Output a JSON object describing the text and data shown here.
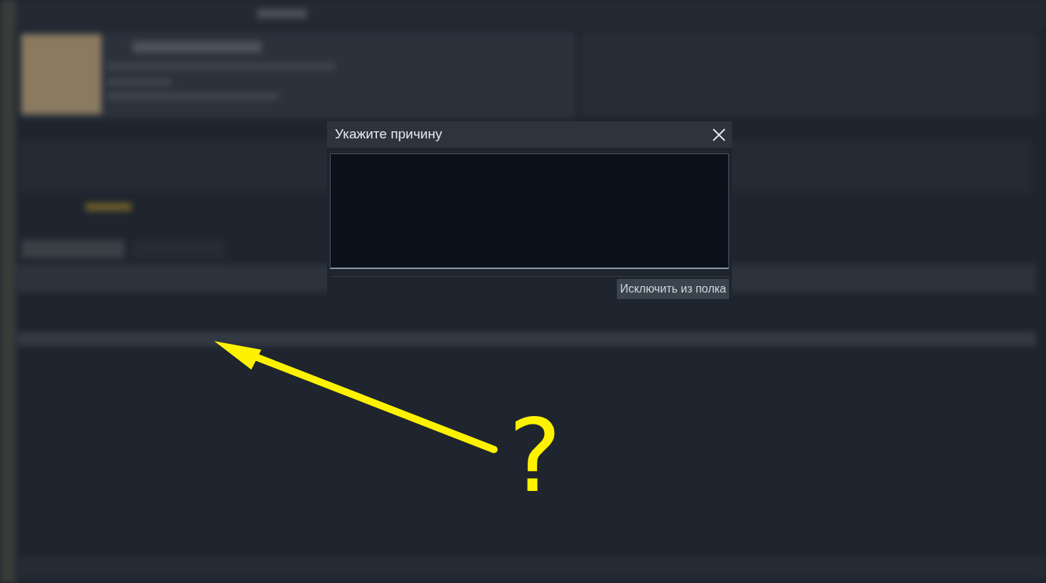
{
  "dialog": {
    "title": "Укажите причину",
    "confirm_button": "Исключить из полка"
  },
  "annotation": {
    "mark": "?"
  }
}
